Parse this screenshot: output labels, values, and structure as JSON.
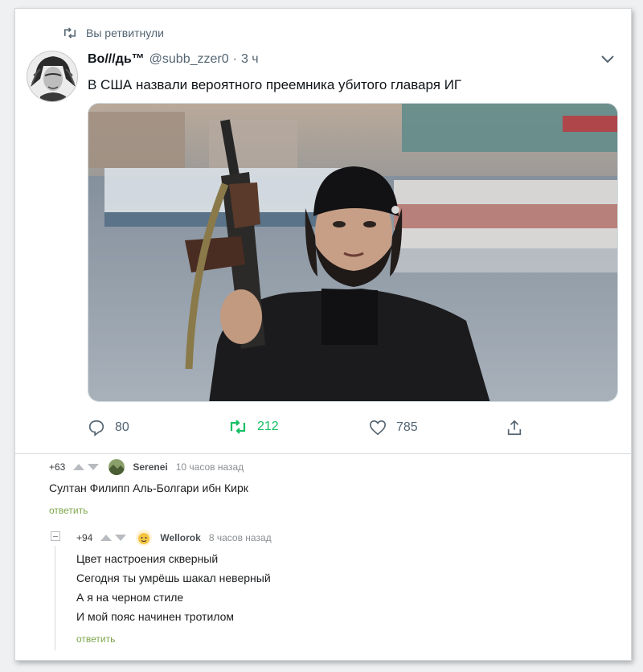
{
  "retweet": {
    "label": "Вы ретвитнули"
  },
  "tweet": {
    "author_name": "Во///дь™",
    "handle": "@subb_zzer0",
    "separator": "·",
    "time": "3 ч",
    "text": "В США назвали вероятного преемника убитого главаря ИГ",
    "avatar_icon": "chief-portrait-avatar",
    "menu_icon": "chevron-down-icon"
  },
  "actions": {
    "reply_count": "80",
    "retweet_count": "212",
    "like_count": "785",
    "retweet_active_color": "#17bf63"
  },
  "comments": [
    {
      "rating": "+63",
      "author": "Serenei",
      "time": "10 часов назад",
      "lines": [
        "Султан Филипп Аль-Болгари ибн Кирк"
      ],
      "reply_label": "ответить"
    },
    {
      "rating": "+94",
      "author": "Wellorok",
      "time": "8 часов назад",
      "lines": [
        "Цвет настроения скверный",
        "Сегодня ты умрёшь шакал неверный",
        "А я на черном стиле",
        "И мой пояс начинен тротилом"
      ],
      "reply_label": "ответить"
    }
  ],
  "colors": {
    "reply_link": "#7da54a",
    "muted": "#536471"
  }
}
